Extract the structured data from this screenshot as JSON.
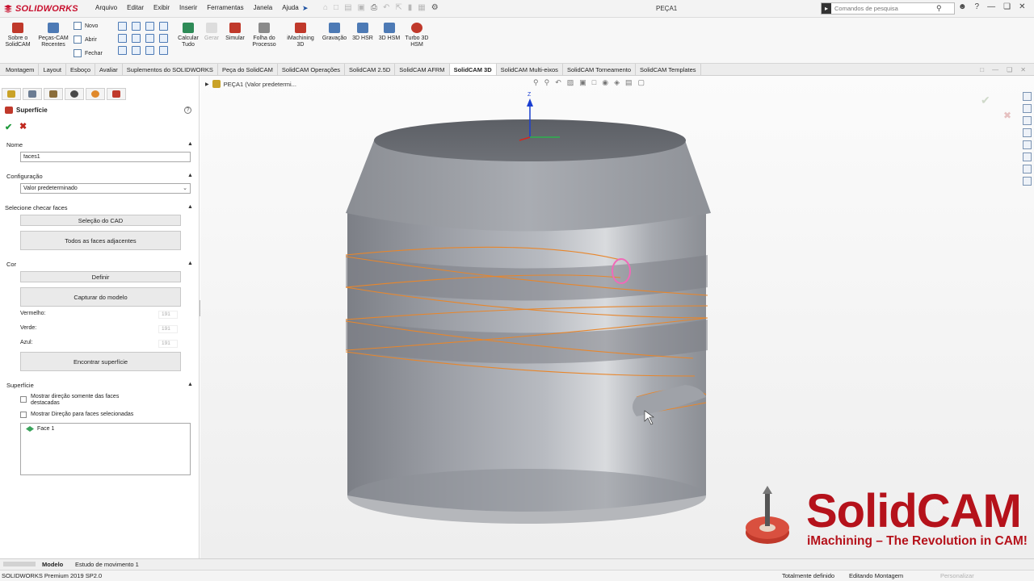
{
  "app": {
    "brand": "SOLIDWORKS",
    "menu": [
      "Arquivo",
      "Editar",
      "Exibir",
      "Inserir",
      "Ferramentas",
      "Janela",
      "Ajuda"
    ],
    "doc_title": "PEÇA1",
    "search_placeholder": "Comandos de pesquisa"
  },
  "ribbon": {
    "buttons": [
      {
        "label": "Sobre o SolidCAM",
        "color": "#c0392b"
      },
      {
        "label": "Peças-CAM Recentes",
        "color": "#4d7ab5"
      },
      {
        "label": "Calcular Tudo",
        "color": "#2e8b57"
      },
      {
        "label": "Gerar",
        "color": "#bbbbbb",
        "disabled": true
      },
      {
        "label": "Simular",
        "color": "#c0392b"
      },
      {
        "label": "Folha do Processo",
        "color": "#8a8a8a"
      },
      {
        "label": "iMachining 3D",
        "color": "#c0392b"
      },
      {
        "label": "Gravação",
        "color": "#4d7ab5"
      },
      {
        "label": "3D HSR",
        "color": "#4d7ab5"
      },
      {
        "label": "3D HSM",
        "color": "#4d7ab5"
      },
      {
        "label": "Turbo 3D HSM",
        "color": "#c0392b"
      }
    ],
    "small": [
      "Novo",
      "Abrir",
      "Fechar"
    ]
  },
  "tabs": {
    "items": [
      "Montagem",
      "Layout",
      "Esboço",
      "Avaliar",
      "Suplementos do SOLIDWORKS",
      "Peça do SolidCAM",
      "SolidCAM Operações",
      "SolidCAM 2.5D",
      "SolidCAM AFRM",
      "SolidCAM 3D",
      "SolidCAM Multi-eixos",
      "SolidCAM Torneamento",
      "SolidCAM Templates"
    ],
    "active": "SolidCAM 3D"
  },
  "panel": {
    "title": "Superfície",
    "name_section": "Nome",
    "name_value": "faces1",
    "config_section": "Configuração",
    "config_value": "Valor predeterminado",
    "select_section": "Selecione checar faces",
    "btn_cad": "Seleção do CAD",
    "btn_adjacent": "Todos as faces adjacentes",
    "color_section": "Cor",
    "btn_define": "Definir",
    "btn_capture": "Capturar do modelo",
    "red_label": "Vermelho:",
    "green_label": "Verde:",
    "blue_label": "Azul:",
    "red_value": "191",
    "green_value": "191",
    "blue_value": "191",
    "btn_find": "Encontrar superfície",
    "surface_section": "Superfície",
    "chk1_label": "Mostrar direção somente das faces destacadas",
    "chk2_label": "Mostrar Direção para faces selecionadas",
    "face_item": "Face 1"
  },
  "viewport": {
    "crumb": "PEÇA1  (Valor predetermi...",
    "axis_label": "Z",
    "brand_word": "SolidCAM",
    "brand_tag": "iMachining – The Revolution in CAM!"
  },
  "bottom_tabs": [
    "Modelo",
    "Estudo de movimento 1"
  ],
  "status": {
    "left": "SOLIDWORKS Premium 2019 SP2.0",
    "defined": "Totalmente definido",
    "editing": "Editando Montagem",
    "custom": "Personalizar"
  },
  "colors": {
    "brand_red": "#b5121b",
    "selection_orange": "#e8862b",
    "model_gray": "#9a9da4"
  }
}
